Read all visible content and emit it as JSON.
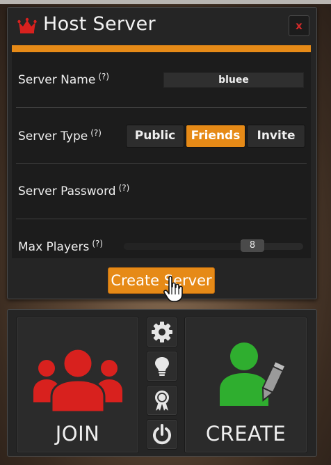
{
  "dialog": {
    "title": "Host Server",
    "close_label": "x",
    "fields": {
      "server_name": {
        "label": "Server Name",
        "help": "(?)",
        "value": "bluee"
      },
      "server_type": {
        "label": "Server Type",
        "help": "(?)",
        "options": [
          "Public",
          "Friends",
          "Invite"
        ],
        "selected": "Friends"
      },
      "server_password": {
        "label": "Server Password",
        "help": "(?)",
        "value": ""
      },
      "max_players": {
        "label": "Max Players",
        "help": "(?)",
        "value": "8"
      }
    },
    "create_button": "Create Server"
  },
  "menu": {
    "join_label": "JOIN",
    "create_label": "CREATE",
    "side_icons": [
      "gear-icon",
      "lightbulb-icon",
      "award-ribbon-icon",
      "power-icon"
    ]
  },
  "colors": {
    "accent": "#e68a17",
    "join": "#d8211e",
    "create": "#2fae2f",
    "close": "#d32a2a"
  }
}
